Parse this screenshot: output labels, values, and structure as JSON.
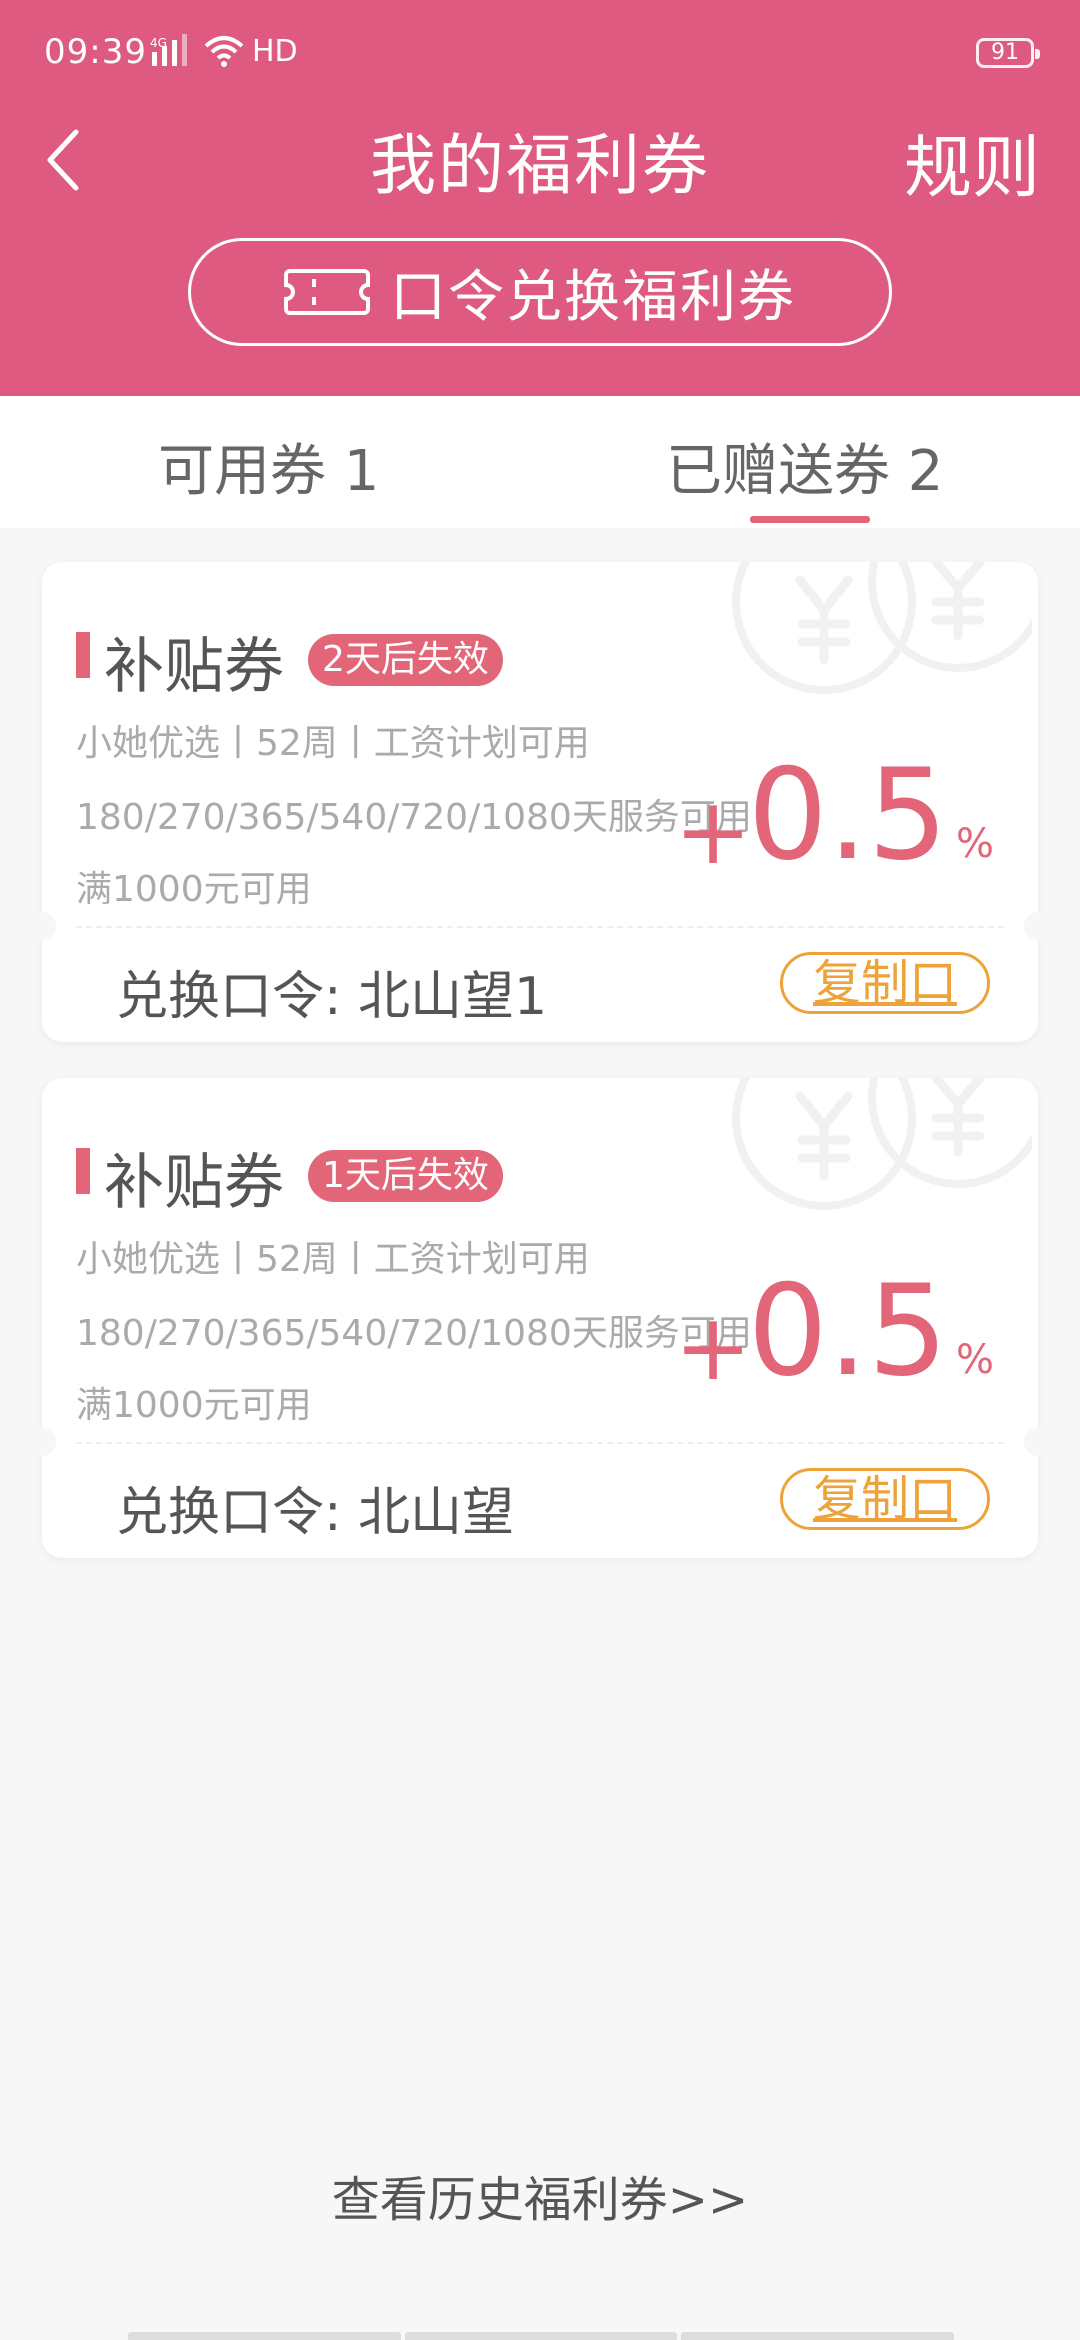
{
  "status_bar": {
    "time": "09:39",
    "network": "HD",
    "battery": "91"
  },
  "header": {
    "title": "我的福利券",
    "rules_label": "规则",
    "redeem_button_label": "口令兑换福利券",
    "background_color": "#de5a80"
  },
  "tabs": [
    {
      "label": "可用券 1",
      "selected": false
    },
    {
      "label": "已赠送券 2",
      "selected": true
    }
  ],
  "coupons": [
    {
      "type": "补贴券",
      "expiry": "2天后失效",
      "line1": "小她优选丨52周丨工资计划可用",
      "line2": "180/270/365/540/720/1080天服务可用",
      "line3": "满1000元可用",
      "value_sign": "+",
      "value": "0.5",
      "value_unit": "%",
      "code_label": "兑换口令:  北山望1",
      "copy_label": "复制口"
    },
    {
      "type": "补贴券",
      "expiry": "1天后失效",
      "line1": "小她优选丨52周丨工资计划可用",
      "line2": "180/270/365/540/720/1080天服务可用",
      "line3": "满1000元可用",
      "value_sign": "+",
      "value": "0.5",
      "value_unit": "%",
      "code_label": "兑换口令:  北山望",
      "copy_label": "复制口"
    }
  ],
  "history_link": "查看历史福利券>>",
  "colors": {
    "accent": "#e26578",
    "copy": "#eda33a"
  },
  "icons": {
    "back": "chevron-left-icon",
    "redeem": "ticket-icon",
    "watermark": "yuan-coin-icon"
  }
}
